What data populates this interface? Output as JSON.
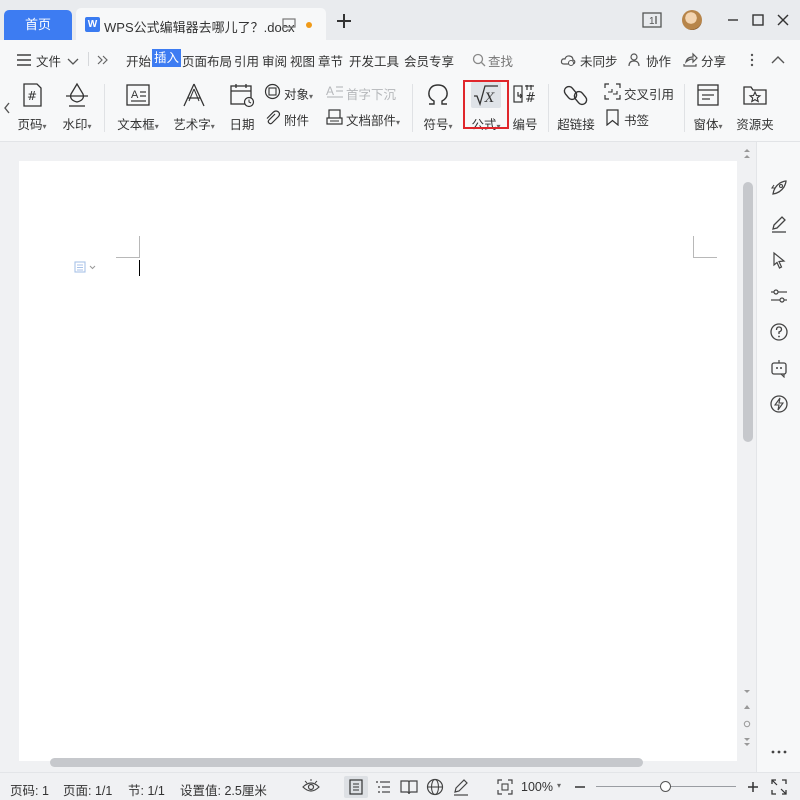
{
  "titlebar": {
    "home_tab": "首页",
    "doc_tab_title": "WPS公式编辑器去哪儿了？.docx",
    "page_badge": "1"
  },
  "menubar": {
    "file_label": "文件",
    "tabs": [
      "开始",
      "插入",
      "页面布局",
      "引用",
      "审阅",
      "视图",
      "章节",
      "开发工具",
      "会员专享"
    ],
    "active_tab": "插入",
    "search_label": "查找",
    "sync_label": "未同步",
    "collab_label": "协作",
    "share_label": "分享"
  },
  "ribbon": {
    "page_number": "页码",
    "watermark": "水印",
    "textbox": "文本框",
    "wordart": "艺术字",
    "date": "日期",
    "object": "对象",
    "attachment": "附件",
    "dropcap": "首字下沉",
    "doc_parts": "文档部件",
    "symbol": "符号",
    "formula": "公式",
    "formula_icon_text": "√X",
    "numbering": "编号",
    "hyperlink": "超链接",
    "cross_ref": "交叉引用",
    "bookmark": "书签",
    "window": "窗体",
    "resource": "资源夹"
  },
  "statusbar": {
    "page_num": "页码: 1",
    "pages": "页面: 1/1",
    "section": "节: 1/1",
    "setting": "设置值: 2.5厘米",
    "zoom": "100%",
    "zoom_level": 0.5
  },
  "colors": {
    "accent": "#3d7cf2",
    "highlight_box": "#e0262b",
    "unsaved_dot": "#f09a18"
  }
}
